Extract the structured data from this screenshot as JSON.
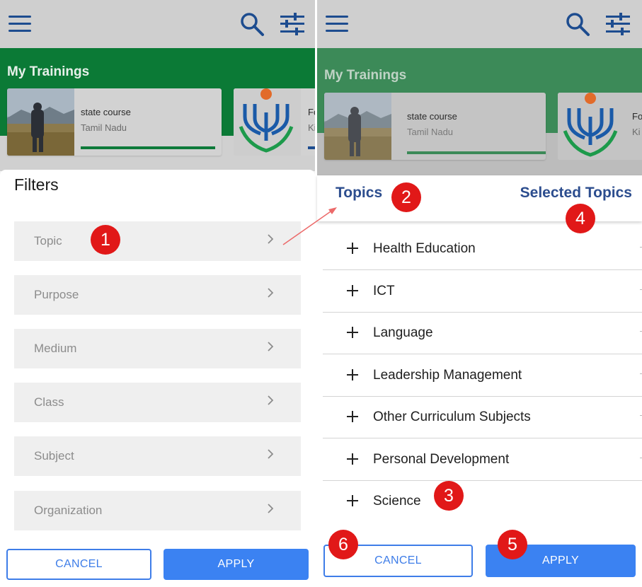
{
  "background_panel": {
    "section_title": "My Trainings",
    "card1": {
      "title": "state course",
      "subtitle": "Tamil Nadu",
      "progress": 1.0
    },
    "card2": {
      "title_peek": "Fo",
      "subtitle_peek": "Ki"
    }
  },
  "filters_sheet": {
    "title": "Filters",
    "items": [
      {
        "label": "Topic"
      },
      {
        "label": "Purpose"
      },
      {
        "label": "Medium"
      },
      {
        "label": "Class"
      },
      {
        "label": "Subject"
      },
      {
        "label": "Organization"
      }
    ],
    "cancel_label": "CANCEL",
    "apply_label": "APPLY"
  },
  "topics_sheet": {
    "tab_topics": "Topics",
    "tab_selected": "Selected Topics",
    "items": [
      {
        "label": "Health Education"
      },
      {
        "label": "ICT"
      },
      {
        "label": "Language"
      },
      {
        "label": "Leadership Management"
      },
      {
        "label": "Other Curriculum Subjects"
      },
      {
        "label": "Personal Development"
      },
      {
        "label": "Science"
      }
    ],
    "cancel_label": "CANCEL",
    "apply_label": "APPLY"
  },
  "annotations": {
    "badges": [
      "1",
      "2",
      "3",
      "4",
      "5",
      "6"
    ]
  },
  "colors": {
    "brand_green": "#0b7a36",
    "nav_blue": "#1d4c8f",
    "topic_blue": "#2c4d8e",
    "button_blue": "#3b82f2",
    "annotation_red": "#e11818"
  },
  "icons": {
    "menu": "menu-icon",
    "search": "search-icon",
    "filter": "tune-icon",
    "chevron": "chevron-right-icon",
    "expand": "plus-icon"
  }
}
